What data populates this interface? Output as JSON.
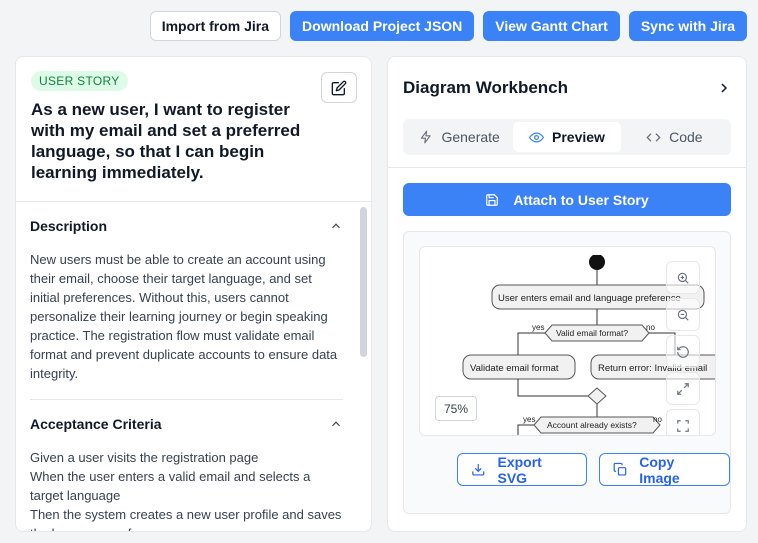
{
  "toolbar": {
    "import_jira": "Import from Jira",
    "download_json": "Download Project JSON",
    "view_gantt": "View Gantt Chart",
    "sync_jira": "Sync with Jira"
  },
  "story": {
    "badge": "USER STORY",
    "title": "As a new user, I want to register with my email and set a preferred language, so that I can begin learning immediately.",
    "description_heading": "Description",
    "description": "New users must be able to create an account using their email, choose their target language, and set initial preferences. Without this, users cannot personalize their learning journey or begin speaking practice. The registration flow must validate email format and prevent duplicate accounts to ensure data integrity.",
    "criteria_heading": "Acceptance Criteria",
    "criteria": [
      "Given a user visits the registration page",
      "When the user enters a valid email and selects a target language",
      "Then the system creates a new user profile and saves the language preference"
    ]
  },
  "workbench": {
    "title": "Diagram Workbench",
    "tabs": [
      {
        "label": "Generate",
        "active": false
      },
      {
        "label": "Preview",
        "active": true
      },
      {
        "label": "Code",
        "active": false
      }
    ],
    "attach_label": "Attach to User Story",
    "zoom_level": "75%",
    "export_svg": "Export SVG",
    "copy_image": "Copy Image"
  },
  "diagram": {
    "node_enter": "User enters email and language preference",
    "decision_email": "Valid email format?",
    "yes_1": "yes",
    "no_1": "no",
    "node_validate": "Validate email format",
    "node_error": "Return error: Invalid email",
    "decision_account": "Account already exists?",
    "yes_2": "yes",
    "no_2": "no"
  },
  "colors": {
    "primary": "#3b82f6",
    "badge_bg": "#dcfce7",
    "badge_text": "#15803d"
  }
}
